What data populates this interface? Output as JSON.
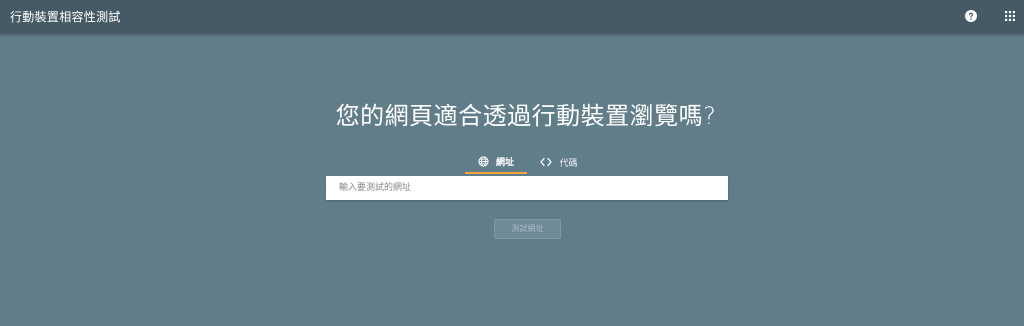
{
  "header": {
    "title": "行動裝置相容性測試",
    "help_icon": "help-circle-icon",
    "apps_icon": "apps-grid-icon"
  },
  "main": {
    "headline": "您的網頁適合透過行動裝置瀏覽嗎?",
    "tabs": [
      {
        "label": "網址",
        "icon": "globe-icon",
        "selected": true
      },
      {
        "label": "代碼",
        "icon": "code-icon",
        "selected": false
      }
    ],
    "url_input": {
      "value": "",
      "placeholder": "輸入要測試的網址"
    },
    "test_button_label": "測試網址"
  },
  "colors": {
    "background": "#617d8a",
    "app_bar": "#455a64",
    "tab_indicator": "#f2a33a"
  }
}
